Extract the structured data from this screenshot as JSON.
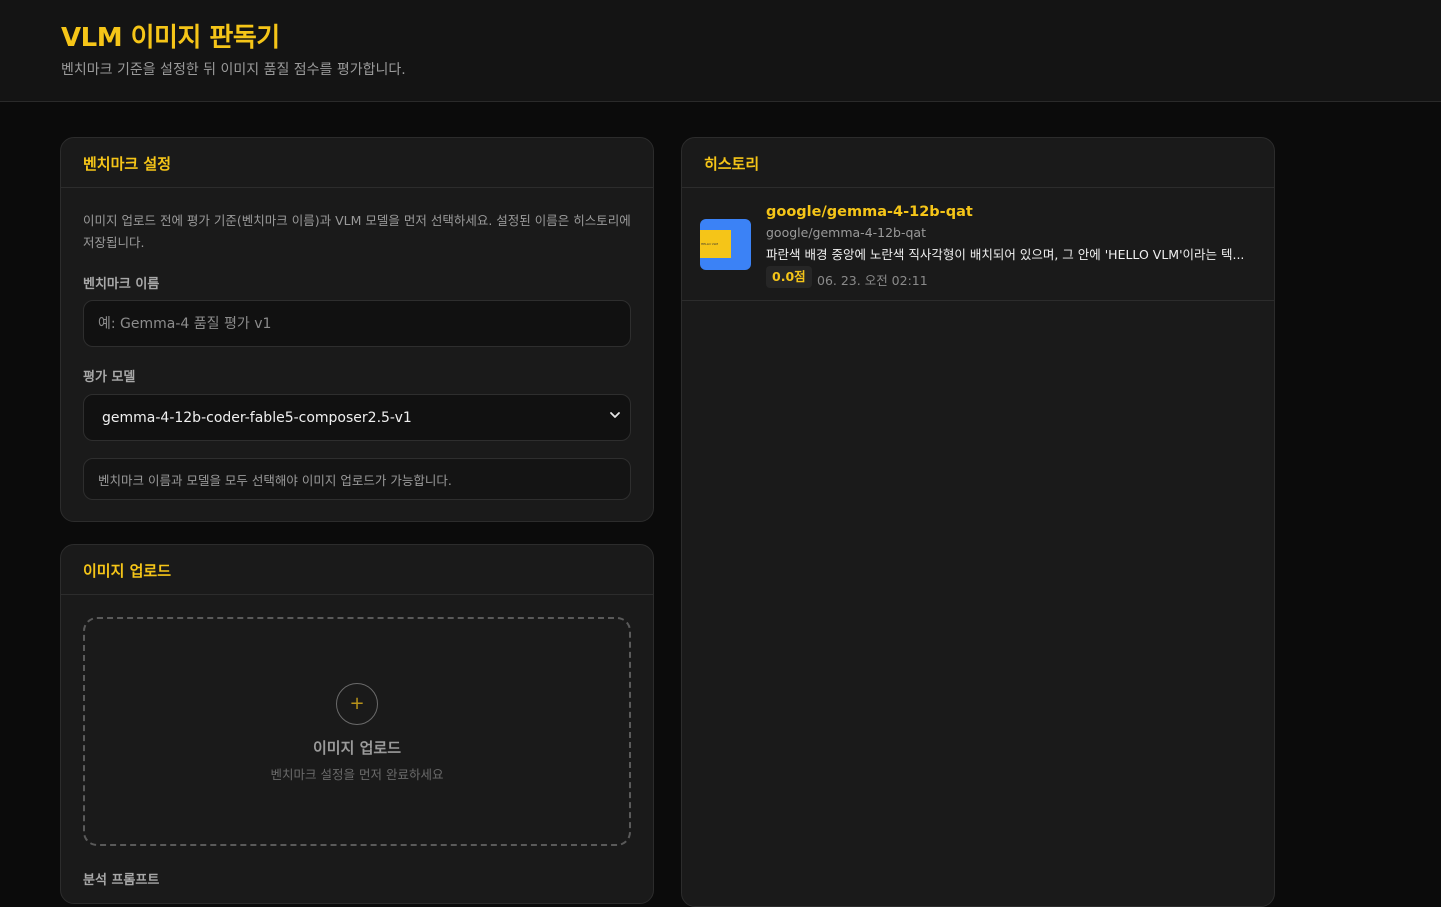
{
  "header": {
    "title": "VLM 이미지 판독기",
    "subtitle": "벤치마크 기준을 설정한 뒤 이미지 품질 점수를 평가합니다."
  },
  "benchmark": {
    "heading": "벤치마크 설정",
    "description": "이미지 업로드 전에 평가 기준(벤치마크 이름)과 VLM 모델을 먼저 선택하세요. 설정된 이름은 히스토리에 저장됩니다.",
    "name_label": "벤치마크 이름",
    "name_value": "",
    "name_placeholder": "예: Gemma-4 품질 평가 v1",
    "model_label": "평가 모델",
    "model_selected": "gemma-4-12b-coder-fable5-composer2.5-v1",
    "notice": "벤치마크 이름과 모델을 모두 선택해야 이미지 업로드가 가능합니다."
  },
  "upload": {
    "heading": "이미지 업로드",
    "plus": "+",
    "drop_title": "이미지 업로드",
    "drop_subtitle": "벤치마크 설정을 먼저 완료하세요",
    "prompt_label": "분석 프롬프트"
  },
  "history": {
    "heading": "히스토리",
    "items": [
      {
        "title": "google/gemma-4-12b-qat",
        "model": "google/gemma-4-12b-qat",
        "description": "파란색 배경 중앙에 노란색 직사각형이 배치되어 있으며, 그 안에 'HELLO VLM'이라는 텍...",
        "score": "0.0점",
        "time": "06. 23. 오전 02:11",
        "thumb_text": "HELLO VLM"
      }
    ]
  },
  "colors": {
    "accent": "#f5c518",
    "background": "#0b0b0b",
    "card": "#1a1a1a",
    "thumb_blue": "#3b82f6"
  }
}
